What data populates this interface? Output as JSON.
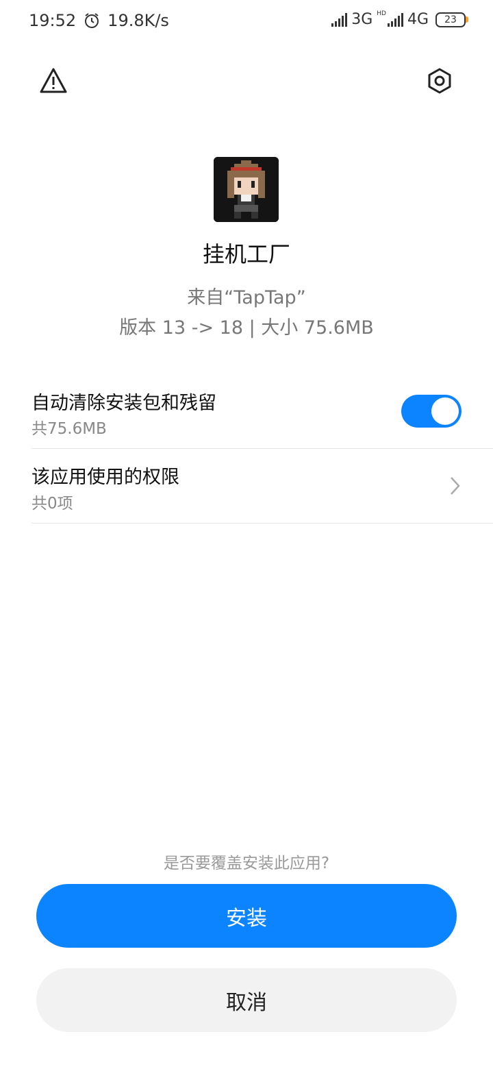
{
  "status_bar": {
    "time": "19:52",
    "net_speed": "19.8K/s",
    "network_1": "3G",
    "hd_label": "HD",
    "network_2": "4G",
    "battery": "23"
  },
  "app": {
    "name": "挂机工厂",
    "source": "来自“TapTap”",
    "version_info": "版本 13 -> 18 | 大小 75.6MB"
  },
  "options": {
    "auto_clean": {
      "title": "自动清除安装包和残留",
      "subtitle": "共75.6MB",
      "enabled": true
    },
    "permissions": {
      "title": "该应用使用的权限",
      "subtitle": "共0项"
    }
  },
  "footer": {
    "prompt": "是否要覆盖安装此应用?",
    "install_label": "安装",
    "cancel_label": "取消"
  },
  "colors": {
    "accent": "#0d84ff",
    "cancel_bg": "#f2f2f2"
  },
  "icons": [
    "alarm-icon",
    "signal-icon",
    "battery-icon",
    "warning-icon",
    "settings-icon",
    "chevron-right-icon"
  ]
}
